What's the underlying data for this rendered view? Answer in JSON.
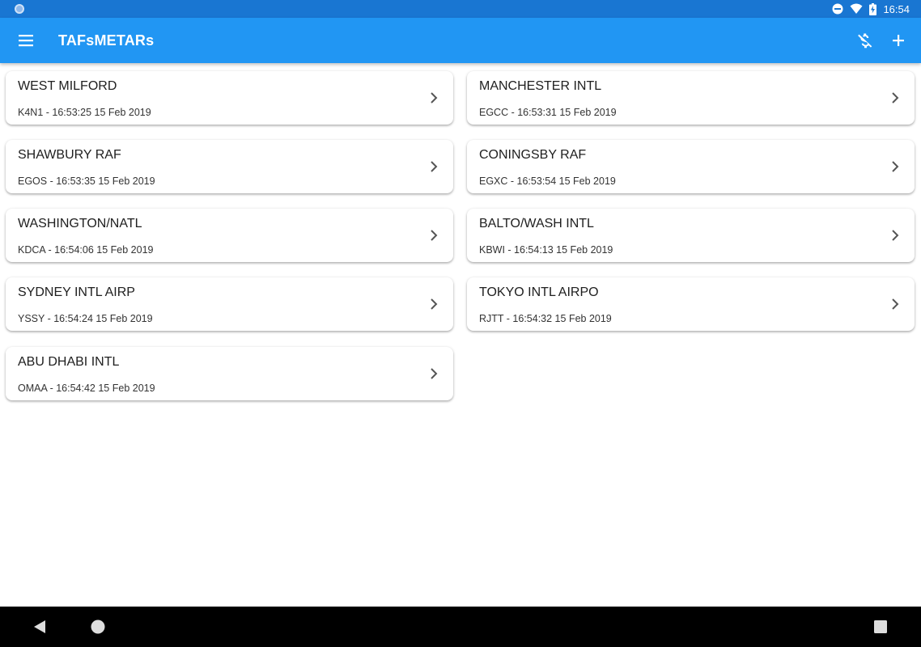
{
  "status_bar": {
    "time": "16:54",
    "icons": [
      "notification-dot-icon",
      "do-not-disturb-icon",
      "wifi-icon",
      "battery-charging-icon"
    ]
  },
  "app_bar": {
    "title": "TAFsMETARs",
    "color": "#2196F3",
    "status_color": "#1976D2",
    "menu_icon": "hamburger-menu-icon",
    "actions": [
      "money-off-icon",
      "add-icon"
    ]
  },
  "stations": [
    {
      "name": "WEST MILFORD",
      "detail": "K4N1 - 16:53:25 15 Feb 2019"
    },
    {
      "name": "MANCHESTER INTL",
      "detail": "EGCC - 16:53:31 15 Feb 2019"
    },
    {
      "name": "SHAWBURY RAF",
      "detail": "EGOS - 16:53:35 15 Feb 2019"
    },
    {
      "name": "CONINGSBY RAF",
      "detail": "EGXC - 16:53:54 15 Feb 2019"
    },
    {
      "name": "WASHINGTON/NATL",
      "detail": "KDCA - 16:54:06 15 Feb 2019"
    },
    {
      "name": "BALTO/WASH INTL",
      "detail": "KBWI - 16:54:13 15 Feb 2019"
    },
    {
      "name": "SYDNEY INTL AIRP",
      "detail": "YSSY - 16:54:24 15 Feb 2019"
    },
    {
      "name": "TOKYO INTL AIRPO",
      "detail": "RJTT - 16:54:32 15 Feb 2019"
    },
    {
      "name": "ABU DHABI INTL",
      "detail": "OMAA - 16:54:42 15 Feb 2019"
    }
  ],
  "nav_bar": {
    "buttons": [
      "back-icon",
      "home-icon",
      "recents-icon"
    ]
  }
}
